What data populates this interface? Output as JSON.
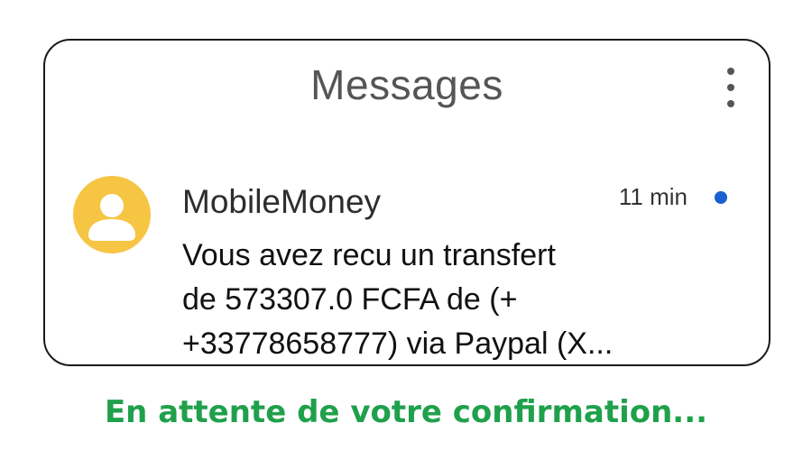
{
  "header": {
    "title": "Messages",
    "menu_icon": "more-vert-icon"
  },
  "conversation": {
    "sender": "MobileMoney",
    "time": "11 min",
    "unread": true,
    "avatar_icon": "person-icon",
    "avatar_color": "#f6c543",
    "unread_color": "#1a5fd0",
    "preview_lines": [
      "Vous avez recu un transfert",
      "de 573307.0 FCFA de (+",
      "+33778658777) via Paypal (X..."
    ]
  },
  "status": {
    "text": "En attente de votre confirmation...",
    "color": "#20a04b"
  }
}
